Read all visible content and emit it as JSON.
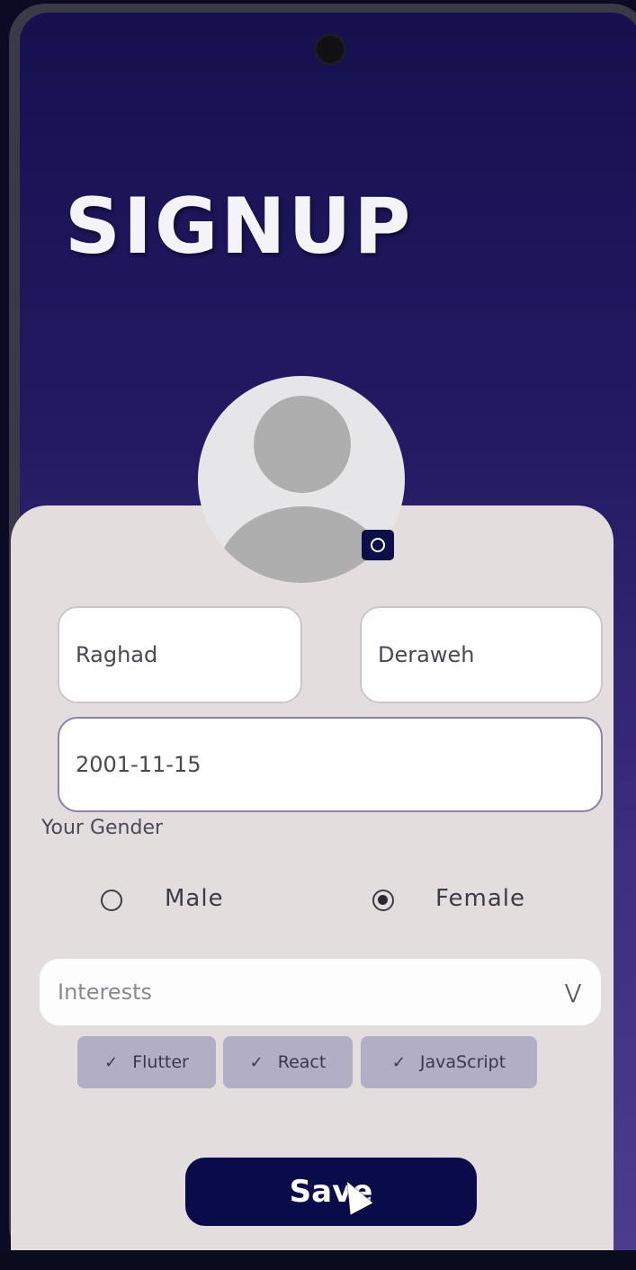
{
  "page": {
    "title": "SIGNUP"
  },
  "profile": {
    "avatar_icon": "person-placeholder-icon",
    "camera_icon": "camera-icon"
  },
  "form": {
    "first_name": "Raghad",
    "last_name": "Deraweh",
    "birth_date": "2001-11-15",
    "gender_label": "Your Gender",
    "gender_options": [
      {
        "label": "Male",
        "selected": false
      },
      {
        "label": "Female",
        "selected": true
      }
    ],
    "interests_placeholder": "Interests",
    "interests_icon": "double-chevron-down-icon",
    "selected_interests": [
      "Flutter",
      "React",
      "JavaScript"
    ],
    "save_label": "Save"
  },
  "colors": {
    "accent": "#0a0c4a",
    "chip": "#b1aec5",
    "card": "#e3dedd",
    "header_gradient_top": "#15104e",
    "header_gradient_bottom": "#4c3c8c"
  }
}
